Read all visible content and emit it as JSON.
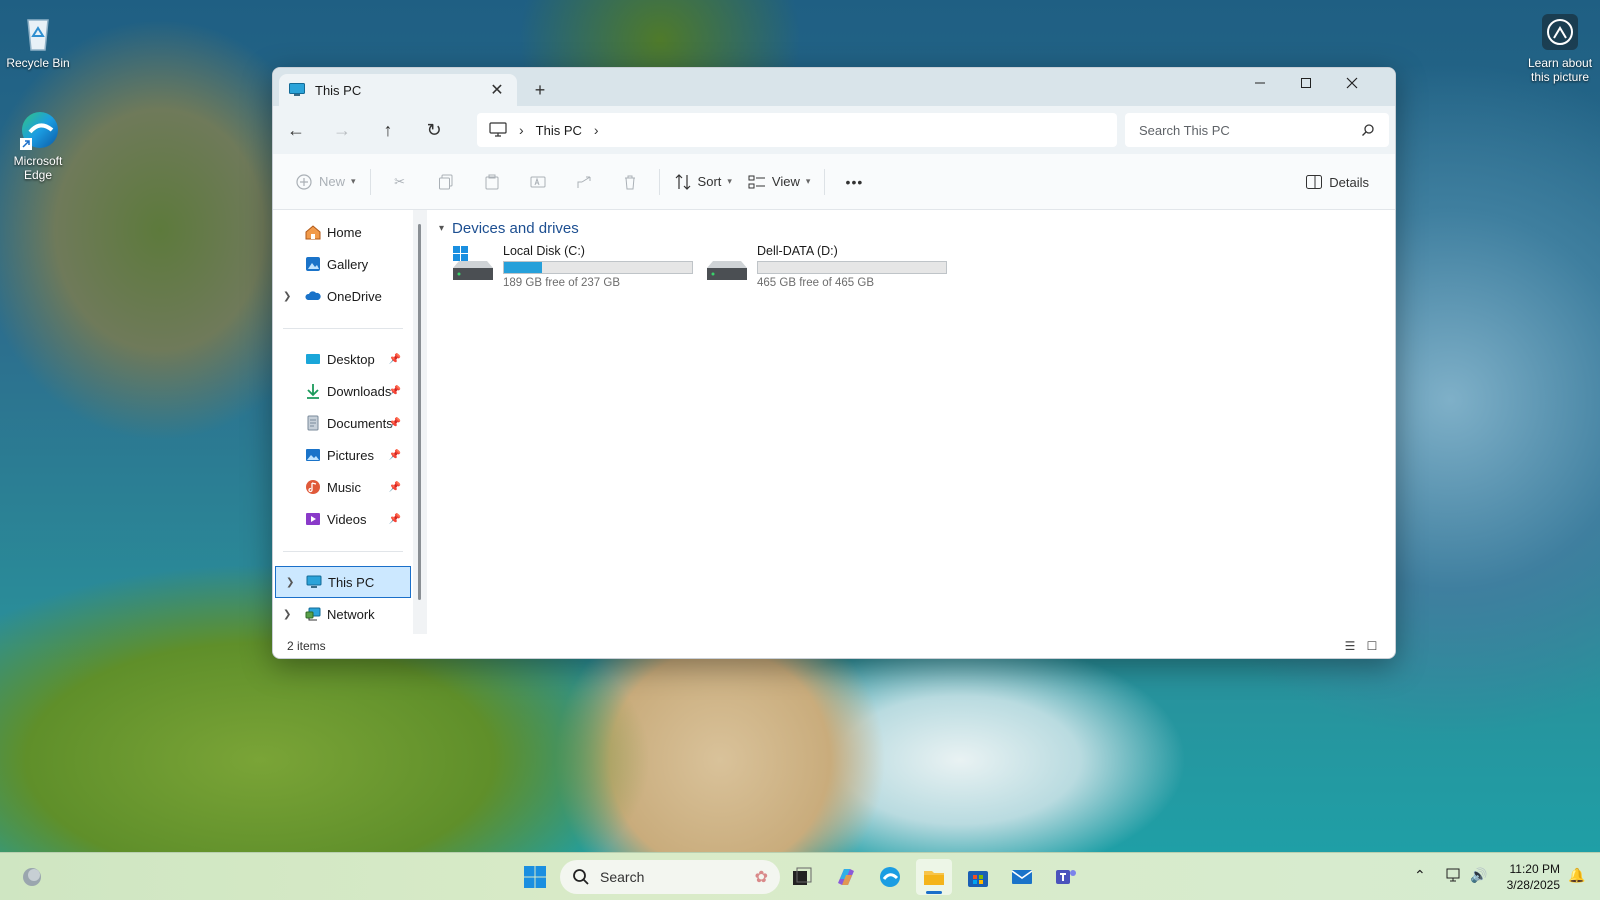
{
  "desktop": {
    "icons": [
      {
        "label": "Recycle Bin"
      },
      {
        "label": "Microsoft Edge"
      }
    ],
    "learn_about": "Learn about this picture"
  },
  "window": {
    "tab_title": "This PC",
    "new_tab_symbol": "+",
    "address": {
      "crumb_root_icon": "monitor-icon",
      "crumb": "This PC"
    },
    "search_placeholder": "Search This PC",
    "toolbar": {
      "new_label": "New",
      "sort_label": "Sort",
      "view_label": "View",
      "more_symbol": "•••",
      "details_label": "Details"
    },
    "nav": {
      "quick": [
        {
          "label": "Home",
          "icon": "home-icon",
          "color": "#e0803a"
        },
        {
          "label": "Gallery",
          "icon": "gallery-icon",
          "color": "#1a73c9"
        },
        {
          "label": "OneDrive",
          "icon": "cloud-icon",
          "color": "#1a73c9"
        }
      ],
      "pinned": [
        {
          "label": "Desktop",
          "icon": "desktop-icon",
          "color": "#1aa6d9"
        },
        {
          "label": "Downloads",
          "icon": "download-icon",
          "color": "#1a9a5a"
        },
        {
          "label": "Documents",
          "icon": "document-icon",
          "color": "#7a8a9a"
        },
        {
          "label": "Pictures",
          "icon": "pictures-icon",
          "color": "#1a73c9"
        },
        {
          "label": "Music",
          "icon": "music-icon",
          "color": "#e05a3a"
        },
        {
          "label": "Videos",
          "icon": "video-icon",
          "color": "#8a3ac9"
        }
      ],
      "roots": [
        {
          "label": "This PC",
          "icon": "pc-icon",
          "selected": true
        },
        {
          "label": "Network",
          "icon": "network-icon",
          "selected": false
        }
      ]
    },
    "content": {
      "group_title": "Devices and drives",
      "drives": [
        {
          "name": "Local Disk (C:)",
          "free_text": "189 GB free of 237 GB",
          "used_fraction": 0.2025,
          "windows": true
        },
        {
          "name": "Dell-DATA (D:)",
          "free_text": "465 GB free of 465 GB",
          "used_fraction": 0.0,
          "windows": false
        }
      ]
    },
    "status": {
      "item_count": "2 items"
    }
  },
  "taskbar": {
    "search_label": "Search",
    "time": "11:20 PM",
    "date": "3/28/2025"
  },
  "colors": {
    "accent": "#1a6fc9",
    "drive_bar_fill": "#26a0da",
    "group_title": "#1d4f91"
  }
}
